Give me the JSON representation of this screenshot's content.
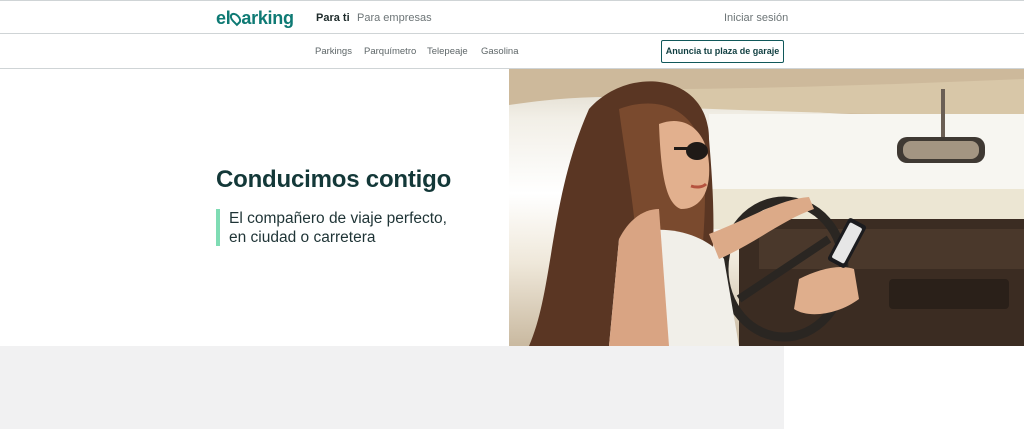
{
  "header": {
    "logo_text": "elparking",
    "nav": [
      {
        "label": "Para ti",
        "active": true
      },
      {
        "label": "Para empresas",
        "active": false
      }
    ],
    "login_label": "Iniciar sesión"
  },
  "subnav": {
    "items": [
      "Parkings",
      "Parquímetro",
      "Telepeaje",
      "Gasolina"
    ],
    "cta_label": "Anuncia tu plaza de garaje"
  },
  "hero": {
    "title": "Conducimos contigo",
    "subtitle_line1": "El compañero de viaje perfecto,",
    "subtitle_line2": "en ciudad o carretera",
    "image_alt": "woman driving car using phone"
  },
  "colors": {
    "brand": "#0e7a74",
    "accent_bar": "#7fdcb4",
    "title": "#133838",
    "footer_bg": "#f1f1f2"
  }
}
